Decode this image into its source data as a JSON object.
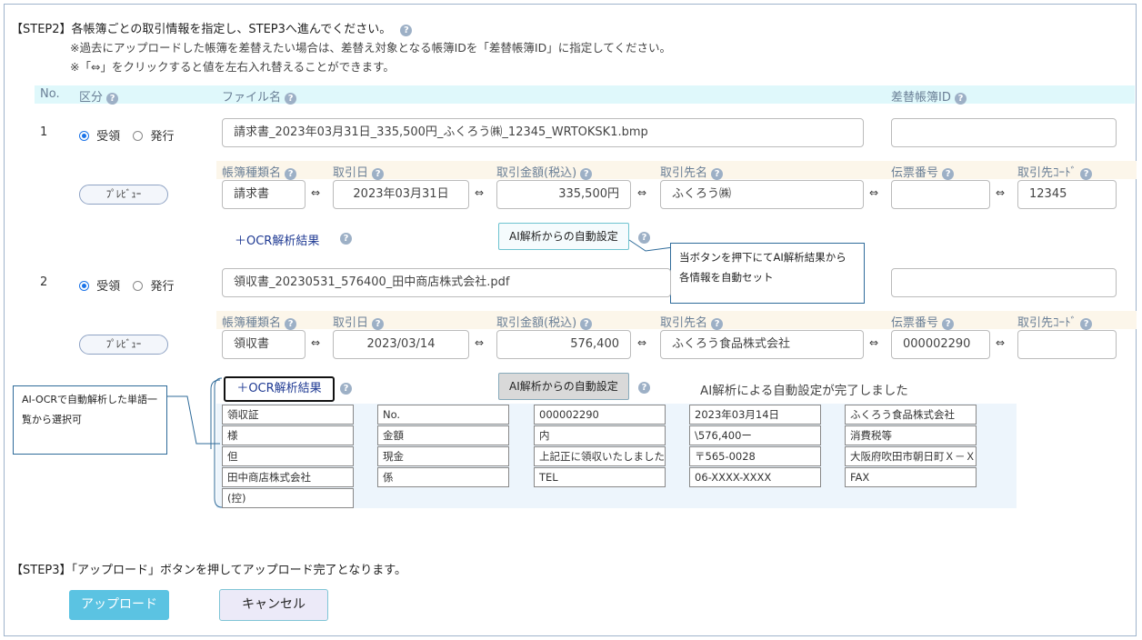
{
  "step2": {
    "title": "【STEP2】各帳簿ごとの取引情報を指定し、STEP3へ進んでください。",
    "note1": "※過去にアップロードした帳簿を差替えたい場合は、差替え対象となる帳簿IDを「差替帳簿ID」に指定してください。",
    "note2": "※「⇔」をクリックすると値を左右入れ替えることができます。"
  },
  "header": {
    "no": "No.",
    "kubun": "区分",
    "filename": "ファイル名",
    "replace_id": "差替帳簿ID"
  },
  "sub_header": {
    "book_type": "帳簿種類名",
    "date": "取引日",
    "amount": "取引金額(税込)",
    "partner": "取引先名",
    "slip_no": "伝票番号",
    "partner_code": "取引先ｺｰﾄﾞ"
  },
  "radio": {
    "receive": "受領",
    "issue": "発行"
  },
  "swap_symbol": "⇔",
  "preview_label": "ﾌﾟﾚﾋﾞｭｰ",
  "ocr_label": "＋OCR解析結果",
  "ai_label": "AI解析からの自動設定",
  "help_symbol": "?",
  "rows": [
    {
      "no": "1",
      "filename": "請求書_2023年03月31日_335,500円_ふくろう㈱_12345_WRTOKSK1.bmp",
      "replace_id": "",
      "book_type": "請求書",
      "date": "2023年03月31日",
      "amount": "335,500円",
      "partner": "ふくろう㈱",
      "slip_no": "",
      "partner_code": "12345"
    },
    {
      "no": "2",
      "filename": "領収書_20230531_576400_田中商店株式会社.pdf",
      "replace_id": "",
      "book_type": "領収書",
      "date": "2023/03/14",
      "amount": "576,400",
      "partner": "ふくろう食品株式会社",
      "slip_no": "000002290",
      "partner_code": ""
    }
  ],
  "callout_ai": "当ボタンを押下にてAI解析結果から各情報を自動セット",
  "callout_ocr": "AI-OCRで自動解析した単語一覧から選択可",
  "ai_done_message": "AI解析による自動設定が完了しました",
  "ocr_words": [
    [
      "領収証",
      "様",
      "但",
      "田中商店株式会社",
      "(控)"
    ],
    [
      "No.",
      "金額",
      "現金",
      "係"
    ],
    [
      "000002290",
      "内",
      "上記正に領収いたしました",
      "TEL"
    ],
    [
      "2023年03月14日",
      "\\576,400ー",
      "〒565-0028",
      "06-XXXX-XXXX"
    ],
    [
      "ふくろう食品株式会社",
      "消費税等",
      "大阪府吹田市朝日町Ｘ－Ｘ",
      "FAX"
    ]
  ],
  "step3": {
    "title": "【STEP3】「アップロード」ボタンを押してアップロード完了となります。"
  },
  "buttons": {
    "upload": "アップロード",
    "cancel": "キャンセル"
  }
}
